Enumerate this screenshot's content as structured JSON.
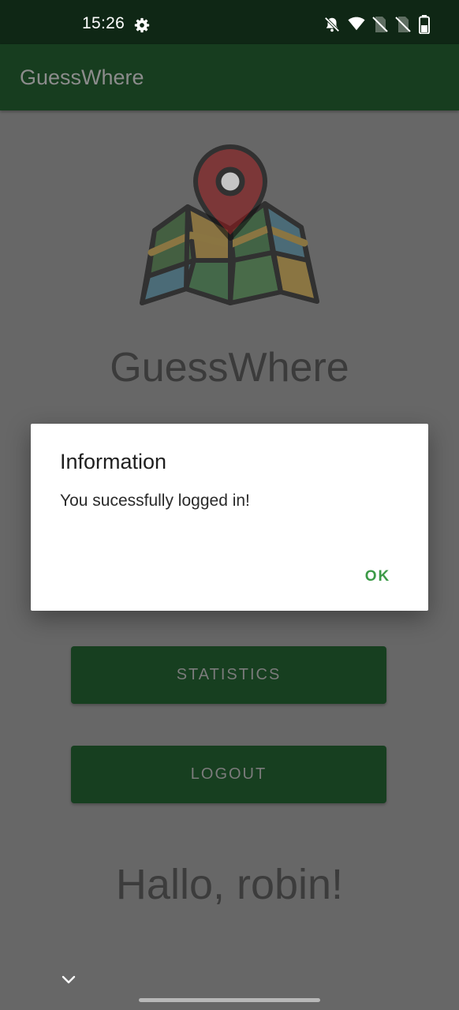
{
  "status_bar": {
    "time": "15:26",
    "icons": [
      "gear-icon",
      "notifications-off-icon",
      "wifi-icon",
      "no-sim-icon",
      "no-sim-icon",
      "battery-icon"
    ]
  },
  "app_bar": {
    "title": "GuessWhere"
  },
  "main": {
    "logo_icon": "map-pin-icon",
    "app_name": "GuessWhere",
    "statistics_button": "STATISTICS",
    "logout_button": "LOGOUT",
    "greeting": "Hallo, robin!"
  },
  "dialog": {
    "title": "Information",
    "message": "You sucessfully logged in!",
    "ok_button": "OK"
  },
  "nav": {
    "chevron_icon": "chevron-down-icon"
  },
  "colors": {
    "status_bar": "#0f2715",
    "app_bar": "#173d1f",
    "button": "#173f20",
    "scrim_background": "#676767",
    "dialog_accent": "#3c9a47"
  }
}
